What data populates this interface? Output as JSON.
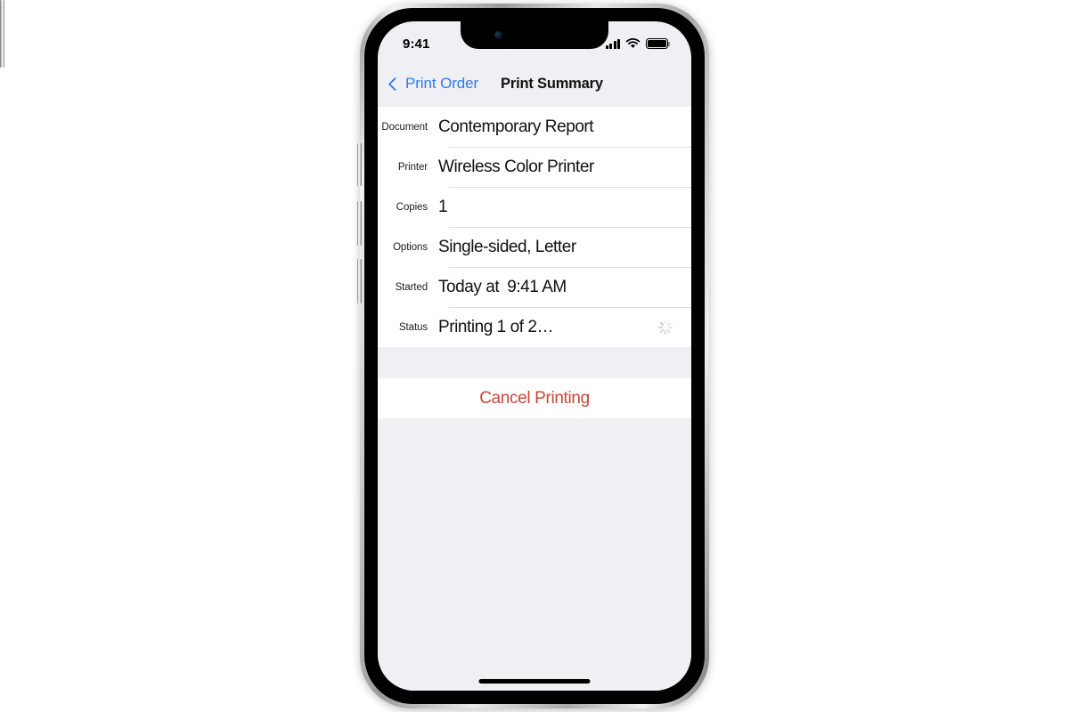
{
  "status_bar": {
    "time": "9:41",
    "cellular_icon": "cellular-bars-icon",
    "wifi_icon": "wifi-icon",
    "battery_icon": "battery-icon"
  },
  "nav_bar": {
    "back_label": "Print Order",
    "back_icon": "chevron-left-icon",
    "title": "Print Summary",
    "accent_color": "#2b7cec"
  },
  "summary": {
    "rows": [
      {
        "label": "Document",
        "value": "Contemporary Report"
      },
      {
        "label": "Printer",
        "value": "Wireless Color Printer"
      },
      {
        "label": "Copies",
        "value": "1"
      },
      {
        "label": "Options",
        "value": "Single-sided, Letter"
      },
      {
        "label": "Started",
        "value": "Today at",
        "value_secondary": "9:41 AM"
      },
      {
        "label": "Status",
        "value": "Printing 1 of 2…",
        "icon": "activity-indicator-icon"
      }
    ]
  },
  "actions": {
    "cancel_label": "Cancel Printing",
    "destructive_color": "#c8453c"
  },
  "theme": {
    "grouped_background": "#efeff4",
    "cell_background": "#ffffff",
    "separator": "#dededf"
  }
}
